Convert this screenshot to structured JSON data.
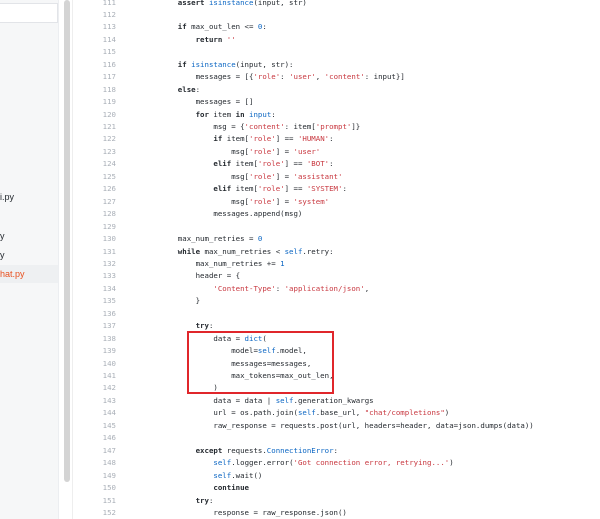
{
  "sidebar": {
    "items": [
      {
        "label": "i.py",
        "active": false
      },
      {
        "label": "y",
        "active": false
      },
      {
        "label": "y",
        "active": false
      },
      {
        "label": "hat.py",
        "active": true
      }
    ]
  },
  "editor": {
    "first_line": 111,
    "lines": [
      [
        [
          "    assert ",
          "kw"
        ],
        [
          "isinstance",
          "bi"
        ],
        [
          "(input, str)",
          ""
        ]
      ],
      [],
      [
        [
          "    if ",
          "kw"
        ],
        [
          "max_out_len <= ",
          ""
        ],
        [
          "0",
          "nu"
        ],
        [
          ":",
          ""
        ]
      ],
      [
        [
          "        return ",
          "kw"
        ],
        [
          "''",
          "st"
        ]
      ],
      [],
      [
        [
          "    if ",
          "kw"
        ],
        [
          "isinstance",
          "bi"
        ],
        [
          "(input, str):",
          ""
        ]
      ],
      [
        [
          "        messages = [{",
          ""
        ],
        [
          "'role'",
          "st"
        ],
        [
          ": ",
          ""
        ],
        [
          "'user'",
          "st"
        ],
        [
          ", ",
          ""
        ],
        [
          "'content'",
          "st"
        ],
        [
          ": input}]",
          ""
        ]
      ],
      [
        [
          "    else",
          "kw"
        ],
        [
          ":",
          ""
        ]
      ],
      [
        [
          "        messages = []",
          ""
        ]
      ],
      [
        [
          "        for ",
          "kw"
        ],
        [
          "item ",
          ""
        ],
        [
          "in ",
          "kw"
        ],
        [
          "input",
          "bi"
        ],
        [
          ":",
          ""
        ]
      ],
      [
        [
          "            msg = {",
          ""
        ],
        [
          "'content'",
          "st"
        ],
        [
          ": item[",
          ""
        ],
        [
          "'prompt'",
          "st"
        ],
        [
          "]}",
          ""
        ]
      ],
      [
        [
          "            if ",
          "kw"
        ],
        [
          "item[",
          ""
        ],
        [
          "'role'",
          "st"
        ],
        [
          "] == ",
          ""
        ],
        [
          "'HUMAN'",
          "st"
        ],
        [
          ":",
          ""
        ]
      ],
      [
        [
          "                msg[",
          ""
        ],
        [
          "'role'",
          "st"
        ],
        [
          "] = ",
          ""
        ],
        [
          "'user'",
          "st"
        ]
      ],
      [
        [
          "            elif ",
          "kw"
        ],
        [
          "item[",
          ""
        ],
        [
          "'role'",
          "st"
        ],
        [
          "] == ",
          ""
        ],
        [
          "'BOT'",
          "st"
        ],
        [
          ":",
          ""
        ]
      ],
      [
        [
          "                msg[",
          ""
        ],
        [
          "'role'",
          "st"
        ],
        [
          "] = ",
          ""
        ],
        [
          "'assistant'",
          "st"
        ]
      ],
      [
        [
          "            elif ",
          "kw"
        ],
        [
          "item[",
          ""
        ],
        [
          "'role'",
          "st"
        ],
        [
          "] == ",
          ""
        ],
        [
          "'SYSTEM'",
          "st"
        ],
        [
          ":",
          ""
        ]
      ],
      [
        [
          "                msg[",
          ""
        ],
        [
          "'role'",
          "st"
        ],
        [
          "] = ",
          ""
        ],
        [
          "'system'",
          "st"
        ]
      ],
      [
        [
          "            messages.append(msg)",
          ""
        ]
      ],
      [],
      [
        [
          "    max_num_retries = ",
          ""
        ],
        [
          "0",
          "nu"
        ]
      ],
      [
        [
          "    while ",
          "kw"
        ],
        [
          "max_num_retries < ",
          ""
        ],
        [
          "self",
          "bi"
        ],
        [
          ".retry:",
          ""
        ]
      ],
      [
        [
          "        max_num_retries += ",
          ""
        ],
        [
          "1",
          "nu"
        ]
      ],
      [
        [
          "        header = {",
          ""
        ]
      ],
      [
        [
          "            ",
          ""
        ],
        [
          "'Content-Type'",
          "st"
        ],
        [
          ": ",
          ""
        ],
        [
          "'application/json'",
          "st"
        ],
        [
          ",",
          ""
        ]
      ],
      [
        [
          "        }",
          ""
        ]
      ],
      [],
      [
        [
          "        try",
          "kw"
        ],
        [
          ":",
          ""
        ]
      ],
      [
        [
          "            data = ",
          ""
        ],
        [
          "dict",
          "bi"
        ],
        [
          "(",
          ""
        ]
      ],
      [
        [
          "                model=",
          ""
        ],
        [
          "self",
          "bi"
        ],
        [
          ".model,",
          ""
        ]
      ],
      [
        [
          "                messages=messages,",
          ""
        ]
      ],
      [
        [
          "                max_tokens=max_out_len,",
          ""
        ]
      ],
      [
        [
          "            )",
          ""
        ]
      ],
      [
        [
          "            data = data | ",
          ""
        ],
        [
          "self",
          "bi"
        ],
        [
          ".generation_kwargs",
          ""
        ]
      ],
      [
        [
          "            url = os.path.join(",
          ""
        ],
        [
          "self",
          "bi"
        ],
        [
          ".base_url, ",
          ""
        ],
        [
          "\"chat/completions\"",
          "st"
        ],
        [
          ")",
          ""
        ]
      ],
      [
        [
          "            raw_response = requests.post(url, headers=header, data=json.dumps(data))",
          ""
        ]
      ],
      [],
      [
        [
          "        except ",
          "kw"
        ],
        [
          "requests.",
          ""
        ],
        [
          "ConnectionError",
          "bi"
        ],
        [
          ":",
          ""
        ]
      ],
      [
        [
          "            ",
          ""
        ],
        [
          "self",
          "bi"
        ],
        [
          ".logger.error(",
          ""
        ],
        [
          "'Got connection error, retrying...'",
          "st"
        ],
        [
          ")",
          ""
        ]
      ],
      [
        [
          "            ",
          ""
        ],
        [
          "self",
          "bi"
        ],
        [
          ".wait()",
          ""
        ]
      ],
      [
        [
          "            continue",
          "kw"
        ]
      ],
      [
        [
          "        try",
          "kw"
        ],
        [
          ":",
          ""
        ]
      ],
      [
        [
          "            response = raw_response.json()",
          ""
        ]
      ]
    ]
  }
}
